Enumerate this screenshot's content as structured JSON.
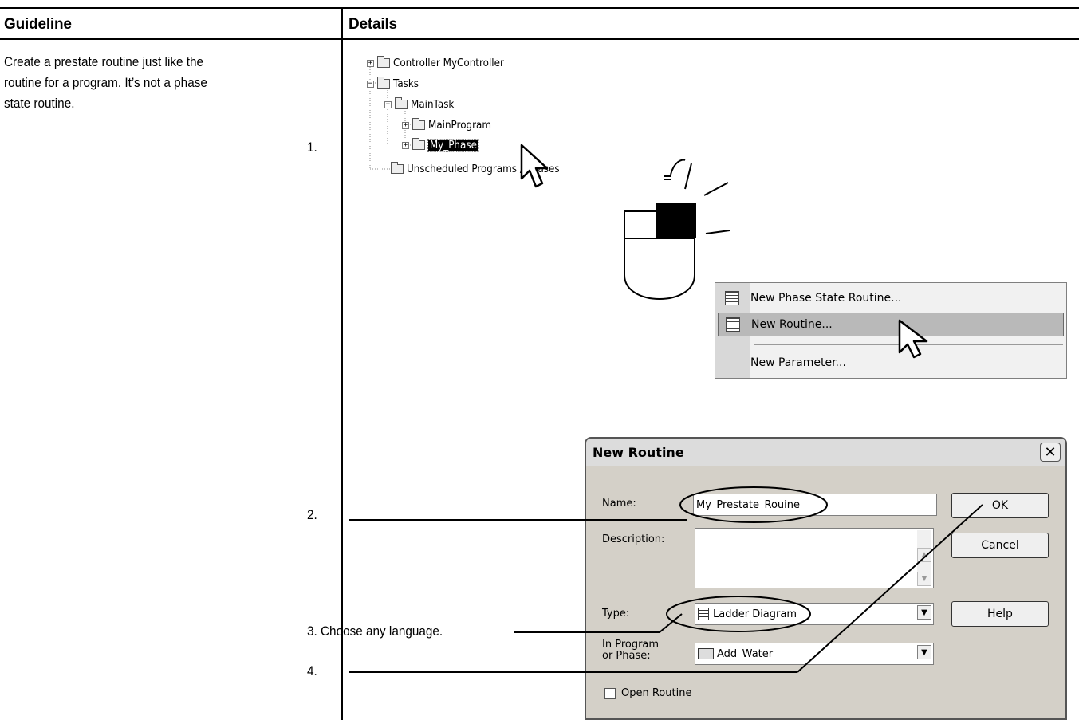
{
  "table": {
    "header_left": "Guideline",
    "header_right": "Details"
  },
  "guideline_text": [
    "Create a prestate routine just like the",
    "routine for a program. It’s not a phase",
    "state routine."
  ],
  "steps": {
    "s1": "1.",
    "s2": "2.",
    "s3": "3. Choose any language.",
    "s4": "4."
  },
  "tree": {
    "controller": "Controller MyController",
    "tasks": "Tasks",
    "main_task": "MainTask",
    "main_program": "MainProgram",
    "my_phase": "My_Phase",
    "unscheduled": "Unscheduled Programs / Phases"
  },
  "context_menu": {
    "item1": "New Phase State Routine...",
    "item2": "New Routine...",
    "item3": "New Parameter..."
  },
  "dialog": {
    "title": "New Routine",
    "name_label": "Name:",
    "name_value": "My_Prestate_Rouine",
    "description_label": "Description:",
    "type_label": "Type:",
    "type_value": "Ladder Diagram",
    "program_label_1": "In Program",
    "program_label_2": "or Phase:",
    "program_value": "Add_Water",
    "open_routine": "Open Routine",
    "ok": "OK",
    "cancel": "Cancel",
    "help": "Help"
  }
}
